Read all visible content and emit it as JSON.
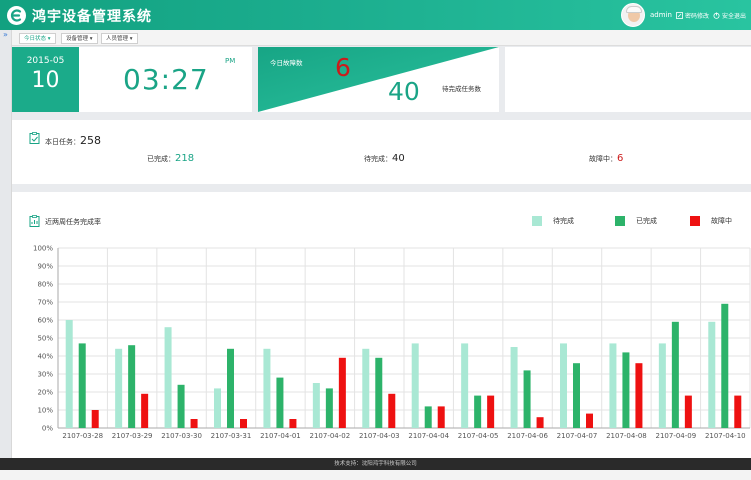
{
  "header": {
    "title": "鸿宇设备管理系统",
    "username": "admin",
    "change_password": "密码修改",
    "logout": "安全退出"
  },
  "nav": {
    "toggle_glyph": "»",
    "menus": [
      {
        "label": "今日状态 ▾",
        "active": true
      },
      {
        "label": "设备管理 ▾",
        "active": false
      },
      {
        "label": "人员管理 ▾",
        "active": false
      }
    ]
  },
  "summary": {
    "year_month": "2015-05",
    "day": "10",
    "time": "03:27",
    "ampm": "PM",
    "fault_label": "今日故障数",
    "fault_count": "6",
    "pending_count": "40",
    "pending_label": "待完成任务数"
  },
  "today": {
    "title": "本日任务：",
    "total": "258",
    "done_label": "已完成：",
    "done": "218",
    "pending_label": "待完成：",
    "pending": "40",
    "fault_label": "故障中：",
    "fault": "6"
  },
  "colors": {
    "brand": "#1aa486",
    "pending": "#a9e8d4",
    "done": "#2db36a",
    "fault": "#ee1111"
  },
  "chart_data": {
    "type": "bar",
    "title": "近两周任务完成率",
    "categories": [
      "2107-03-28",
      "2107-03-29",
      "2107-03-30",
      "2107-03-31",
      "2107-04-01",
      "2107-04-02",
      "2107-04-03",
      "2107-04-04",
      "2107-04-05",
      "2107-04-06",
      "2107-04-07",
      "2107-04-08",
      "2107-04-09",
      "2107-04-10"
    ],
    "series": [
      {
        "name": "待完成",
        "values": [
          60,
          44,
          56,
          22,
          44,
          25,
          44,
          47,
          47,
          45,
          47,
          47,
          47,
          59
        ]
      },
      {
        "name": "已完成",
        "values": [
          47,
          46,
          24,
          44,
          28,
          22,
          39,
          12,
          18,
          32,
          36,
          42,
          59,
          69
        ]
      },
      {
        "name": "故障中",
        "values": [
          10,
          19,
          5,
          5,
          5,
          39,
          19,
          12,
          18,
          6,
          8,
          36,
          18,
          18
        ]
      }
    ],
    "ylim": [
      0,
      100
    ],
    "yticks": [
      "0%",
      "10%",
      "20%",
      "30%",
      "40%",
      "50%",
      "60%",
      "70%",
      "80%",
      "90%",
      "100%"
    ],
    "grid": true,
    "legend": "top-right"
  },
  "footer": {
    "text": "技术支持：沈阳鸿宇科技有限公司"
  }
}
